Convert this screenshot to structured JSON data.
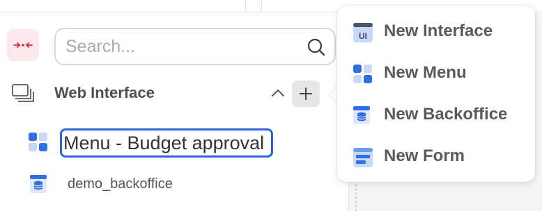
{
  "search": {
    "placeholder": "Search..."
  },
  "tree": {
    "group_title": "Web Interface",
    "items": [
      {
        "label": "Menu - Budget approval",
        "editing": true,
        "icon": "menu-grid-icon"
      },
      {
        "label": "demo_backoffice",
        "icon": "backoffice-icon"
      }
    ]
  },
  "popup": {
    "items": [
      {
        "label": "New Interface",
        "icon": "ui-interface-icon"
      },
      {
        "label": "New Menu",
        "icon": "menu-grid-icon"
      },
      {
        "label": "New Backoffice",
        "icon": "backoffice-icon"
      },
      {
        "label": "New Form",
        "icon": "form-icon"
      }
    ]
  },
  "colors": {
    "accent_blue": "#2f62e0",
    "collapse_bg": "#fde9ec",
    "collapse_icon": "#e0293f"
  }
}
